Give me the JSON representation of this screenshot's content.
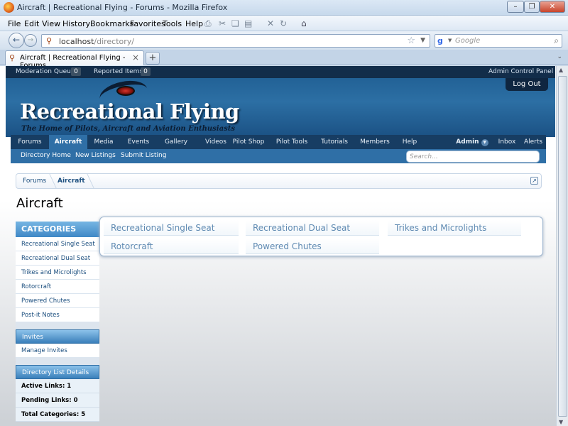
{
  "window": {
    "title": "Aircraft | Recreational Flying - Forums - Mozilla Firefox",
    "controls": [
      "minimize",
      "restore",
      "close"
    ]
  },
  "menu": [
    "File",
    "Edit",
    "View",
    "History",
    "Bookmarks",
    "Favorites",
    "Tools",
    "Help"
  ],
  "nav": {
    "url_host": "localhost",
    "url_path": "/directory/",
    "search_placeholder": "Google"
  },
  "tabs": [
    {
      "label": "Aircraft | Recreational Flying - Forums"
    }
  ],
  "site": {
    "moderation_label": "Moderation Queue:",
    "moderation_count": "0",
    "reported_label": "Reported Items:",
    "reported_count": "0",
    "admin_panel": "Admin Control Panel",
    "logout": "Log Out",
    "title": "Recreational Flying",
    "tagline": "The Home of Pilots, Aircraft and Aviation Enthusiasts",
    "main_nav": [
      "Forums",
      "Aircraft",
      "Media",
      "Events",
      "Gallery",
      "Videos",
      "Pilot Shop",
      "Pilot Tools",
      "Tutorials",
      "Members",
      "Help"
    ],
    "active_nav": "Aircraft",
    "user_nav": [
      "Admin",
      "Inbox",
      "Alerts"
    ],
    "sub_nav": [
      "Directory Home",
      "New Listings",
      "Submit Listing"
    ],
    "search_placeholder": "Search..."
  },
  "breadcrumb": [
    "Forums",
    "Aircraft"
  ],
  "page_title": "Aircraft",
  "sidebar": {
    "categories_title": "CATEGORIES",
    "categories": [
      "Recreational Single Seat",
      "Recreational Dual Seat",
      "Trikes and Microlights",
      "Rotorcraft",
      "Powered Chutes",
      "Post-it Notes"
    ],
    "invites_title": "Invites",
    "invites_items": [
      "Manage Invites"
    ],
    "details_title": "Directory List Details",
    "details": [
      "Active Links: 1",
      "Pending Links: 0",
      "Total Categories: 5"
    ]
  },
  "category_grid": [
    "Recreational Single Seat",
    "Recreational Dual Seat",
    "Trikes and Microlights",
    "Rotorcraft",
    "Powered Chutes"
  ]
}
